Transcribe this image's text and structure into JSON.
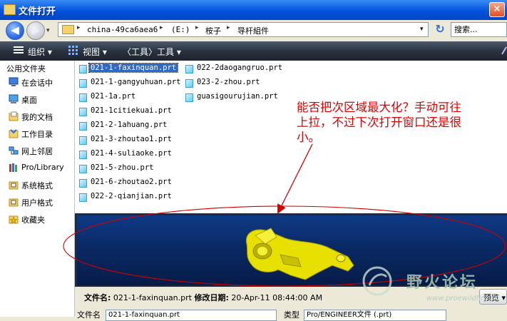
{
  "window": {
    "title": "文件打开",
    "close_symbol": "×"
  },
  "nav": {
    "back_symbol": "◀",
    "forward_symbol": "▶",
    "breadcrumb": [
      "china-49ca6aea6",
      "(E:)",
      "桉子",
      "导杆組件"
    ],
    "search_placeholder": "搜索..."
  },
  "toolbar": {
    "organize": "组织 ▾",
    "view": "视图 ▾",
    "tools": "〈工具〉工具 ▾"
  },
  "sidebar": {
    "title": "公用文件夹",
    "items": [
      {
        "label": "在会话中",
        "icon": "monitor-icon"
      },
      {
        "label": "桌面",
        "icon": "desktop-icon"
      },
      {
        "label": "我的文档",
        "icon": "my-documents-icon"
      },
      {
        "label": "工作目录",
        "icon": "working-directory-icon"
      },
      {
        "label": "网上邻居",
        "icon": "network-icon"
      },
      {
        "label": "Pro/Library",
        "icon": "library-icon"
      },
      {
        "label": "系统格式",
        "icon": "system-format-icon"
      },
      {
        "label": "用户格式",
        "icon": "user-format-icon"
      },
      {
        "label": "收藏夹",
        "icon": "favorites-icon"
      }
    ]
  },
  "files": {
    "col1": [
      "021-1-faxinquan.prt",
      "021-1-gangyuhuan.prt",
      "021-1a.prt",
      "021-1citiekuai.prt",
      "021-2-1ahuang.prt",
      "021-3-zhoutao1.prt",
      "021-4-suliaoke.prt",
      "021-5-zhou.prt",
      "021-6-zhoutao2.prt",
      "022-2-qianjian.prt"
    ],
    "col2": [
      "022-2daogangruo.prt",
      "023-2-zhou.prt",
      "guasigourujian.prt"
    ],
    "selected": "021-1-faxinquan.prt"
  },
  "annotation": {
    "line1": "能否把次区域最大化？手动可往",
    "line2": "上拉，不过下次打开窗口还是很",
    "line3": "小。"
  },
  "details": {
    "filename_label": "文件名:",
    "filename_value": "021-1-faxinquan.prt",
    "modified_label": "修改日期:",
    "modified_value": "20-Apr-11 08:44:00 AM",
    "preview_button": "预览 ▾"
  },
  "bottom": {
    "name_label": "文件名",
    "name_value": "021-1-faxinquan.prt",
    "type_label": "类型",
    "type_value": "Pro/ENGINEER文件 (.prt)"
  },
  "watermark": {
    "text": "野火论坛",
    "url": "www.proewildfire.cn"
  },
  "colors": {
    "accent": "#316ac5",
    "annotation": "#e00000",
    "titlebar": "#0a5ce2"
  }
}
